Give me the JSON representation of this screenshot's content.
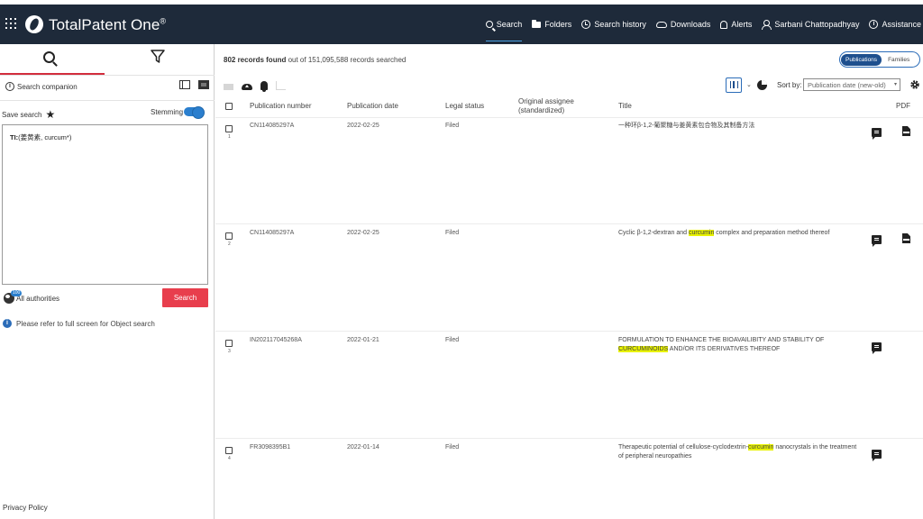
{
  "app": {
    "logo_text": "TotalPatent One",
    "logo_reg": "®"
  },
  "nav": {
    "items": [
      {
        "label": "Search",
        "icon": "search-icon",
        "active": true
      },
      {
        "label": "Folders",
        "icon": "folder-icon"
      },
      {
        "label": "Search history",
        "icon": "history-icon"
      },
      {
        "label": "Downloads",
        "icon": "download-cloud-icon"
      },
      {
        "label": "Alerts",
        "icon": "bell-icon"
      },
      {
        "label": "Sarbani Chattopadhyay",
        "icon": "user-icon"
      },
      {
        "label": "Assistance",
        "icon": "info-icon"
      }
    ]
  },
  "sidebar": {
    "companion_label": "Search companion",
    "save_search_label": "Save search",
    "stemming_label": "Stemming",
    "stemming_on": true,
    "query_field": "TI:",
    "query_text": "(姜黄素, curcum*)",
    "authorities_badge": "100",
    "authorities_label": "All authorities",
    "search_button": "Search",
    "refer_text": "Please refer to full screen for Object search",
    "privacy_label": "Privacy Policy"
  },
  "results": {
    "records_count": "802 records found",
    "records_rest": " out of 151,095,588 records searched",
    "view_toggle": {
      "on": "Publications",
      "off": "Families"
    },
    "sort_label": "Sort by:",
    "sort_value": "Publication date (new-old)",
    "columns": {
      "number": "Publication number",
      "date": "Publication date",
      "status": "Legal status",
      "assignee": "Original assignee",
      "assignee_sub": "(standardized)",
      "title": "Title",
      "pdf": "PDF"
    },
    "rows": [
      {
        "index": "1",
        "number": "CN114085297A",
        "date": "2022-02-25",
        "status": "Filed",
        "title_pre": "一种环β-1,2-葡聚糖与姜黄素包合物及其制备方法",
        "title_hl": "",
        "title_post": "",
        "has_pdf": true
      },
      {
        "index": "2",
        "number": "CN114085297A",
        "date": "2022-02-25",
        "status": "Filed",
        "title_pre": "Cyclic β-1,2-dextran and ",
        "title_hl": "curcumin",
        "title_post": " complex and preparation method thereof",
        "has_pdf": true
      },
      {
        "index": "3",
        "number": "IN202117045268A",
        "date": "2022-01-21",
        "status": "Filed",
        "title_pre": "FORMULATION TO ENHANCE THE BIOAVAILIBITY AND STABILITY OF ",
        "title_hl": "CURCUMINOIDS",
        "title_post": " AND/OR ITS DERIVATIVES THEREOF",
        "has_pdf": false
      },
      {
        "index": "4",
        "number": "FR3098395B1",
        "date": "2022-01-14",
        "status": "Filed",
        "title_pre": "Therapeutic potential of cellulose-cyclodextrin-",
        "title_hl": "curcumin",
        "title_post": " nanocrystals in the treatment of peripheral neuropathies",
        "has_pdf": false
      }
    ]
  }
}
